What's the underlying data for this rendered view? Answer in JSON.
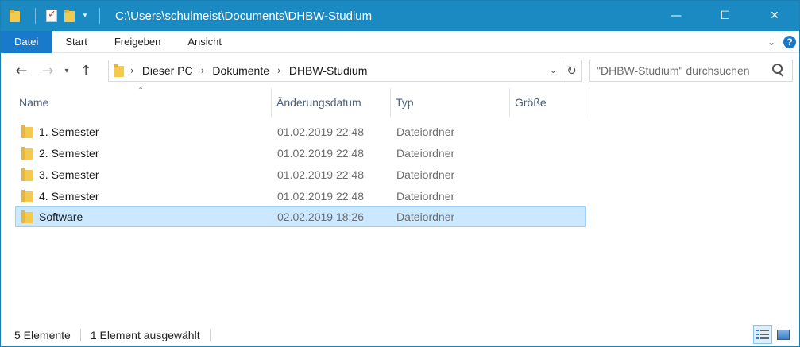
{
  "window": {
    "title": "C:\\Users\\schulmeist\\Documents\\DHBW-Studium",
    "controls": {
      "minimize": "—",
      "maximize": "☐",
      "close": "✕"
    },
    "colors": {
      "titlebar": "#1b8ac2",
      "file_tab": "#1979ca",
      "selection": "#cce8ff"
    }
  },
  "ribbon": {
    "tabs": [
      "Datei",
      "Start",
      "Freigeben",
      "Ansicht"
    ]
  },
  "address": {
    "crumbs": [
      "Dieser PC",
      "Dokumente",
      "DHBW-Studium"
    ]
  },
  "search": {
    "placeholder": "\"DHBW-Studium\" durchsuchen"
  },
  "columns": [
    "Name",
    "Änderungsdatum",
    "Typ",
    "Größe"
  ],
  "files": [
    {
      "name": "1. Semester",
      "date": "01.02.2019 22:48",
      "type": "Dateiordner",
      "selected": false
    },
    {
      "name": "2. Semester",
      "date": "01.02.2019 22:48",
      "type": "Dateiordner",
      "selected": false
    },
    {
      "name": "3. Semester",
      "date": "01.02.2019 22:48",
      "type": "Dateiordner",
      "selected": false
    },
    {
      "name": "4. Semester",
      "date": "01.02.2019 22:48",
      "type": "Dateiordner",
      "selected": false
    },
    {
      "name": "Software",
      "date": "02.02.2019 18:26",
      "type": "Dateiordner",
      "selected": true
    }
  ],
  "status": {
    "count": "5 Elemente",
    "selection": "1 Element ausgewählt"
  }
}
